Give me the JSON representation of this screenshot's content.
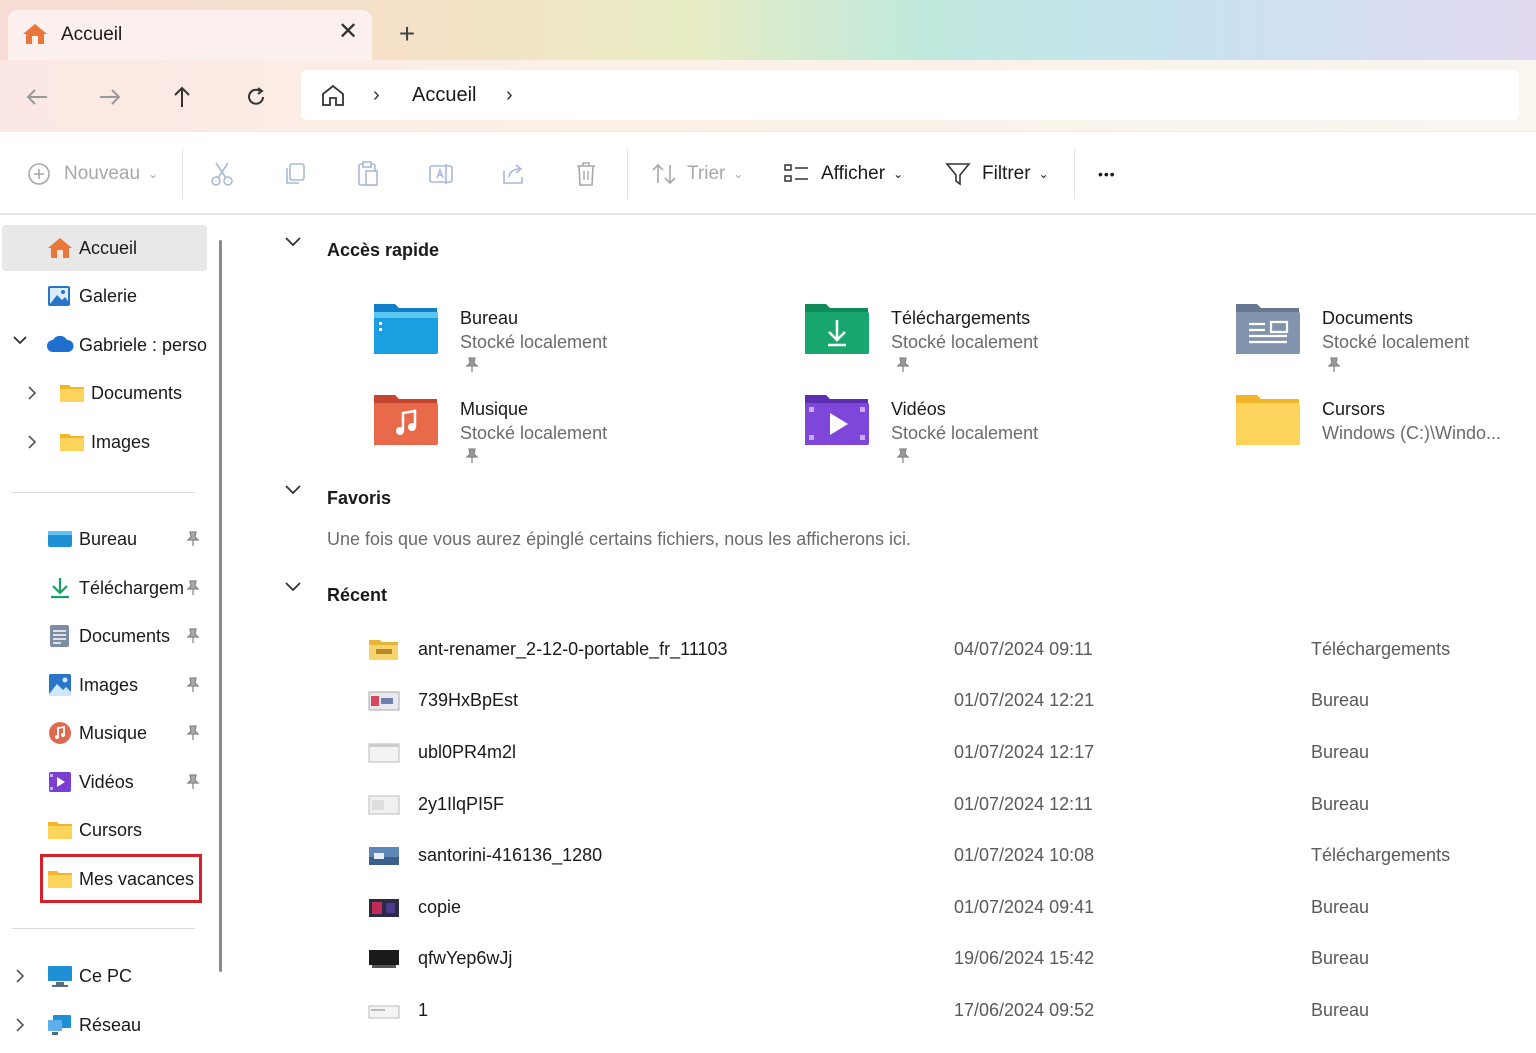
{
  "window": {
    "tab_title": "Accueil",
    "close_glyph": "✕",
    "new_tab_glyph": "+"
  },
  "nav": {
    "breadcrumb": [
      "Accueil"
    ],
    "separator": "›"
  },
  "commands": {
    "new_label": "Nouveau",
    "sort_label": "Trier",
    "view_label": "Afficher",
    "filter_label": "Filtrer",
    "more_glyph": "•••",
    "chevron": "⌄"
  },
  "sidebar": {
    "top": [
      {
        "label": "Accueil",
        "icon": "home-icon",
        "selected": true
      },
      {
        "label": "Galerie",
        "icon": "gallery-icon"
      },
      {
        "label": "Gabriele : personnel",
        "icon": "onedrive-icon",
        "expanded": true
      },
      {
        "label": "Documents",
        "icon": "folder-icon"
      },
      {
        "label": "Images",
        "icon": "folder-icon"
      }
    ],
    "pinned": [
      {
        "label": "Bureau",
        "icon": "desktop-icon",
        "pinned": true
      },
      {
        "label": "Téléchargements",
        "icon": "download-icon",
        "pinned": true
      },
      {
        "label": "Documents",
        "icon": "documents-icon",
        "pinned": true
      },
      {
        "label": "Images",
        "icon": "pictures-icon",
        "pinned": true
      },
      {
        "label": "Musique",
        "icon": "music-icon",
        "pinned": true
      },
      {
        "label": "Vidéos",
        "icon": "videos-icon",
        "pinned": true
      },
      {
        "label": "Cursors",
        "icon": "folder-icon"
      },
      {
        "label": "Mes vacances",
        "icon": "folder-icon",
        "highlighted": true
      }
    ],
    "bottom": [
      {
        "label": "Ce PC",
        "icon": "pc-icon"
      },
      {
        "label": "Réseau",
        "icon": "network-icon"
      }
    ],
    "pin_glyph": "📌"
  },
  "main": {
    "quick_access": {
      "title": "Accès rapide",
      "items": [
        {
          "name": "Bureau",
          "sub": "Stocké localement",
          "icon": "desktop-folder-icon",
          "pinned": true
        },
        {
          "name": "Téléchargements",
          "sub": "Stocké localement",
          "icon": "downloads-folder-icon",
          "pinned": true
        },
        {
          "name": "Documents",
          "sub": "Stocké localement",
          "icon": "documents-folder-icon",
          "pinned": true
        },
        {
          "name": "Musique",
          "sub": "Stocké localement",
          "icon": "music-folder-icon",
          "pinned": true
        },
        {
          "name": "Vidéos",
          "sub": "Stocké localement",
          "icon": "videos-folder-icon",
          "pinned": true
        },
        {
          "name": "Cursors",
          "sub": "Windows (C:)\\Windo...",
          "icon": "folder-icon",
          "pinned": false
        }
      ]
    },
    "favorites": {
      "title": "Favoris",
      "message": "Une fois que vous aurez épinglé certains fichiers, nous les afficherons ici."
    },
    "recent": {
      "title": "Récent",
      "rows": [
        {
          "name": "ant-renamer_2-12-0-portable_fr_11103",
          "date": "04/07/2024 09:11",
          "location": "Téléchargements",
          "thumb": "zip-icon"
        },
        {
          "name": "739HxBpEst",
          "date": "01/07/2024 12:21",
          "location": "Bureau",
          "thumb": "image-thumb"
        },
        {
          "name": "ubl0PR4m2l",
          "date": "01/07/2024 12:17",
          "location": "Bureau",
          "thumb": "image-thumb"
        },
        {
          "name": "2y1IlqPI5F",
          "date": "01/07/2024 12:11",
          "location": "Bureau",
          "thumb": "image-thumb"
        },
        {
          "name": "santorini-416136_1280",
          "date": "01/07/2024 10:08",
          "location": "Téléchargements",
          "thumb": "image-thumb"
        },
        {
          "name": "copie",
          "date": "01/07/2024 09:41",
          "location": "Bureau",
          "thumb": "image-thumb"
        },
        {
          "name": "qfwYep6wJj",
          "date": "19/06/2024 15:42",
          "location": "Bureau",
          "thumb": "image-thumb"
        },
        {
          "name": "1",
          "date": "17/06/2024 09:52",
          "location": "Bureau",
          "thumb": "image-thumb"
        }
      ]
    }
  },
  "colors": {
    "highlight_box": "#d6202a",
    "selected_bg": "#e8e8e8",
    "folder_yellow": "#f7c948"
  }
}
